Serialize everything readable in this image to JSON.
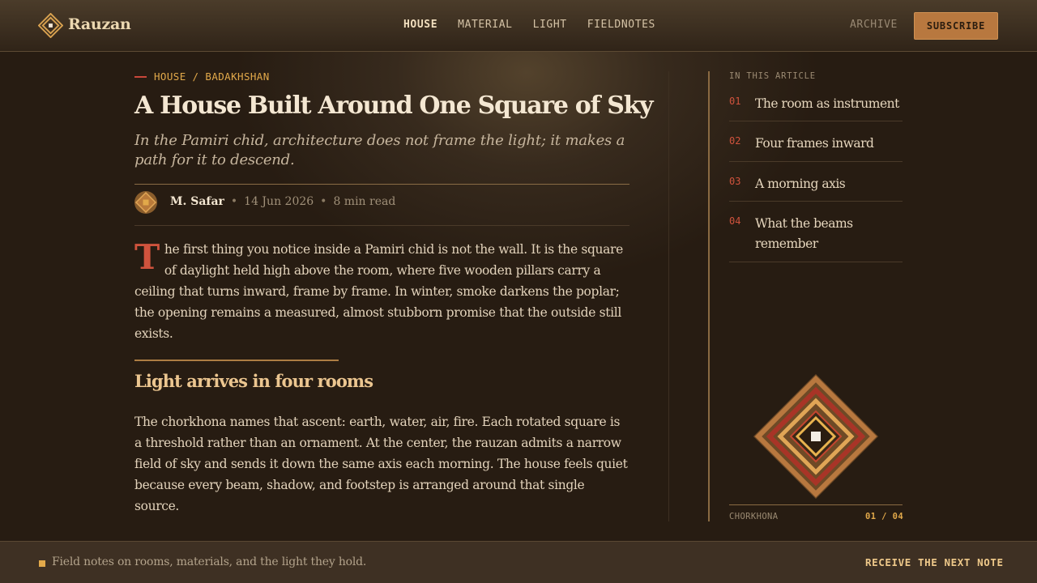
{
  "header": {
    "brand": "Rauzan",
    "nav": [
      {
        "label": "HOUSE",
        "active": true
      },
      {
        "label": "MATERIAL",
        "active": false
      },
      {
        "label": "LIGHT",
        "active": false
      },
      {
        "label": "FIELDNOTES",
        "active": false
      }
    ],
    "archive_label": "ARCHIVE",
    "subscribe_label": "SUBSCRIBE"
  },
  "article": {
    "kicker": "HOUSE / BADAKHSHAN",
    "title": "A House Built Around One Square of Sky",
    "subtitle": "In the Pamiri chid, architecture does not frame the light; it makes a path for it to descend.",
    "author": "M. Safar",
    "date": "14 Jun 2026",
    "read_time": "8 min read",
    "byline_separator": "•",
    "dropcap": "T",
    "paragraph1_rest": "he first thing you notice inside a Pamiri chid is not the wall. It is the square of daylight held high above the room, where five wooden pillars carry a ceiling that turns inward, frame by frame. In winter, smoke darkens the poplar; the opening remains a measured, almost stubborn promise that the outside still exists.",
    "section_heading": "Light arrives in four rooms",
    "paragraph2": "The chorkhona names that ascent: earth, water, air, fire. Each rotated square is a threshold rather than an ornament. At the center, the rauzan admits a narrow field of sky and sends it down the same axis each morning. The house feels quiet because every beam, shadow, and footstep is arranged around that single source."
  },
  "sidebar": {
    "toc_label": "IN THIS ARTICLE",
    "items": [
      {
        "num": "01",
        "label": "The room as instrument"
      },
      {
        "num": "02",
        "label": "Four frames inward"
      },
      {
        "num": "03",
        "label": "A morning axis"
      },
      {
        "num": "04",
        "label": "What the beams remember"
      }
    ],
    "ornament_caption": "CHORKHONA",
    "ornament_count": "01 / 04"
  },
  "footer": {
    "text": "Field notes on rooms, materials, and the light they hold.",
    "link": "RECEIVE THE NEXT NOTE"
  },
  "colors": {
    "accent_gold": "#e2a94a",
    "accent_red": "#d0533d",
    "accent_copper": "#b8783f",
    "background": "#271c12"
  }
}
